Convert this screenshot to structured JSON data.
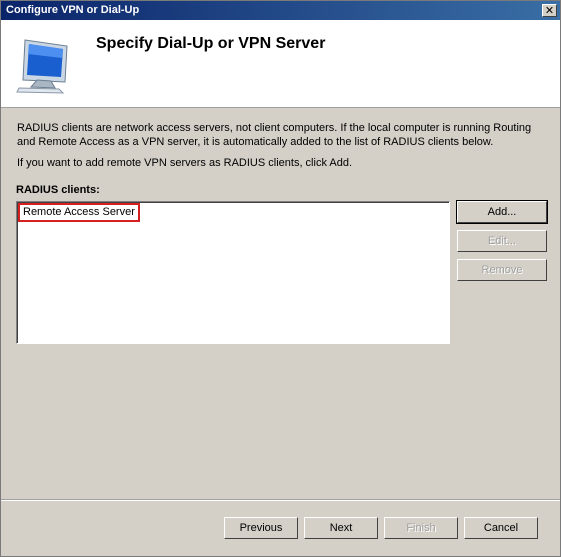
{
  "window": {
    "title": "Configure VPN or Dial-Up",
    "close_label": "✕"
  },
  "header": {
    "title": "Specify Dial-Up or VPN Server",
    "icon": "computer-monitor-icon"
  },
  "description": {
    "paragraph1": "RADIUS clients are network access servers, not client computers. If the local computer is running Routing and Remote Access as a VPN server, it is automatically added to the list of RADIUS clients below.",
    "paragraph2": "If you want to add remote VPN servers as RADIUS clients, click Add."
  },
  "radius_clients": {
    "label": "RADIUS clients:",
    "items": [
      "Remote Access Server"
    ]
  },
  "side_buttons": {
    "add": "Add...",
    "edit": "Edit...",
    "remove": "Remove"
  },
  "footer": {
    "previous": "Previous",
    "next": "Next",
    "finish": "Finish",
    "cancel": "Cancel"
  },
  "colors": {
    "titlebar_start": "#0a246a",
    "titlebar_end": "#3a6ea5",
    "highlight_border": "#d61f1f"
  }
}
